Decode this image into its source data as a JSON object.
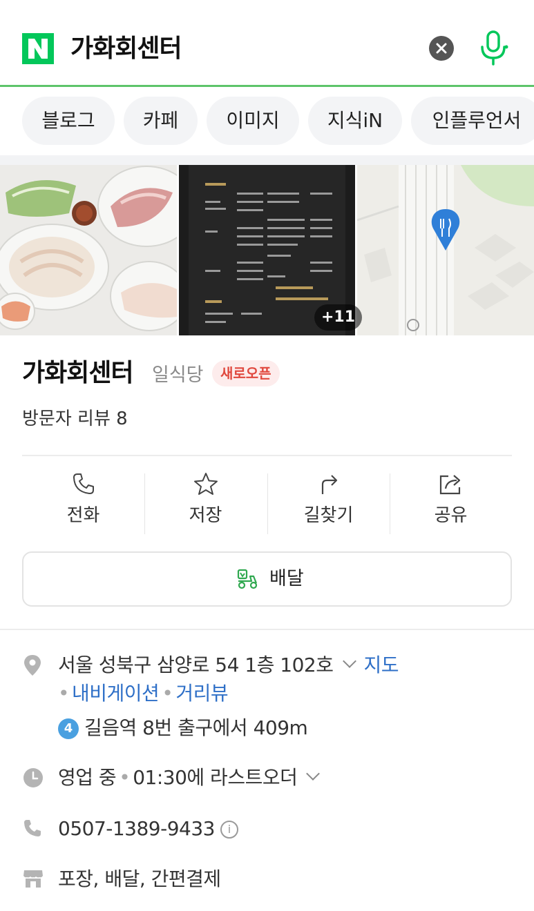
{
  "search": {
    "query": "가화회센터"
  },
  "icons": {
    "logo": "naver-n-logo",
    "clear": "close-icon",
    "mic": "microphone-icon"
  },
  "tabs": [
    "블로그",
    "카페",
    "이미지",
    "지식iN",
    "인플루언서"
  ],
  "photos": {
    "more_count": "+11"
  },
  "place": {
    "name": "가화회센터",
    "category": "일식당",
    "badge": "새로오픈",
    "reviews": "방문자 리뷰 8"
  },
  "actions": [
    {
      "label": "전화",
      "icon": "phone-icon"
    },
    {
      "label": "저장",
      "icon": "star-icon"
    },
    {
      "label": "길찾기",
      "icon": "directions-icon"
    },
    {
      "label": "공유",
      "icon": "share-icon"
    }
  ],
  "delivery": {
    "label": "배달",
    "icon": "delivery-scooter-icon"
  },
  "info": {
    "address": "서울 성북구 삼양로 54 1층 102호",
    "map_link": "지도",
    "navigation_link": "내비게이션",
    "street_view_link": "거리뷰",
    "station_line": "4",
    "station_text": "길음역 8번 출구에서 409m",
    "status": "영업 중",
    "last_order": "01:30에 라스트오더",
    "phone": "0507-1389-9433",
    "services": "포장, 배달, 간편결제"
  },
  "colors": {
    "accent_green": "#03c75a",
    "link_blue": "#2e6fc7",
    "badge_red": "#e0483e",
    "line4_blue": "#4aa0e0"
  }
}
